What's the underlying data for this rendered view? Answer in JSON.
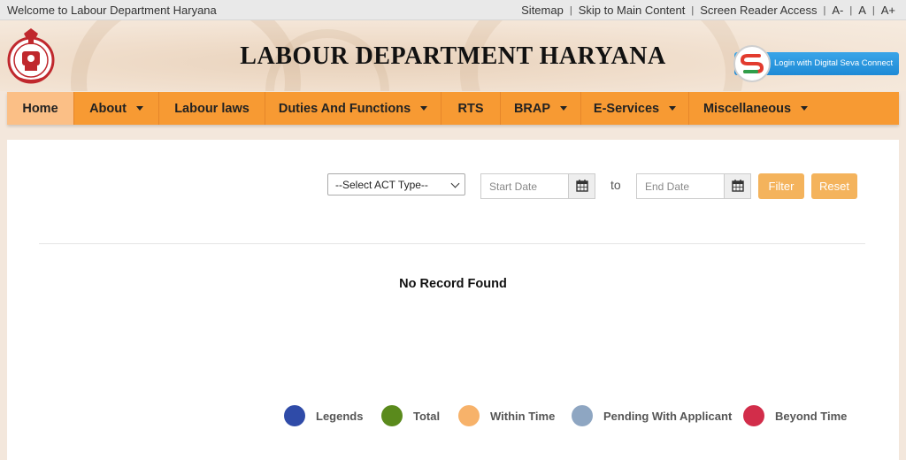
{
  "topbar": {
    "welcome": "Welcome to Labour Department Haryana",
    "links": [
      "Sitemap",
      "Skip to Main Content",
      "Screen Reader Access",
      "A-",
      "A",
      "A+"
    ]
  },
  "header": {
    "title": "LABOUR DEPARTMENT HARYANA",
    "login_button": "Login with Digital Seva Connect"
  },
  "nav": {
    "items": [
      {
        "label": "Home",
        "dropdown": false,
        "active": true
      },
      {
        "label": "About",
        "dropdown": true
      },
      {
        "label": "Labour laws",
        "dropdown": false
      },
      {
        "label": "Duties And Functions",
        "dropdown": true
      },
      {
        "label": "RTS",
        "dropdown": false
      },
      {
        "label": "BRAP",
        "dropdown": true
      },
      {
        "label": "E-Services",
        "dropdown": true
      },
      {
        "label": "Miscellaneous",
        "dropdown": true
      }
    ]
  },
  "filter": {
    "act_select": "--Select ACT Type--",
    "start_placeholder": "Start Date",
    "to_label": "to",
    "end_placeholder": "End Date",
    "filter_button": "Filter",
    "reset_button": "Reset"
  },
  "results": {
    "message": "No Record Found"
  },
  "legend": [
    {
      "label": "Legends",
      "color": "#2f4ba8"
    },
    {
      "label": "Total",
      "color": "#5a8a1c"
    },
    {
      "label": "Within Time",
      "color": "#f7b26a"
    },
    {
      "label": "Pending With Applicant",
      "color": "#8ea6c2"
    },
    {
      "label": "Beyond Time",
      "color": "#d22d4a"
    }
  ],
  "colors": {
    "nav_bg": "#f79a33",
    "nav_active": "#fbbf86",
    "button_bg": "#f4b35c",
    "login_button_bg": "#1e8ad6"
  }
}
